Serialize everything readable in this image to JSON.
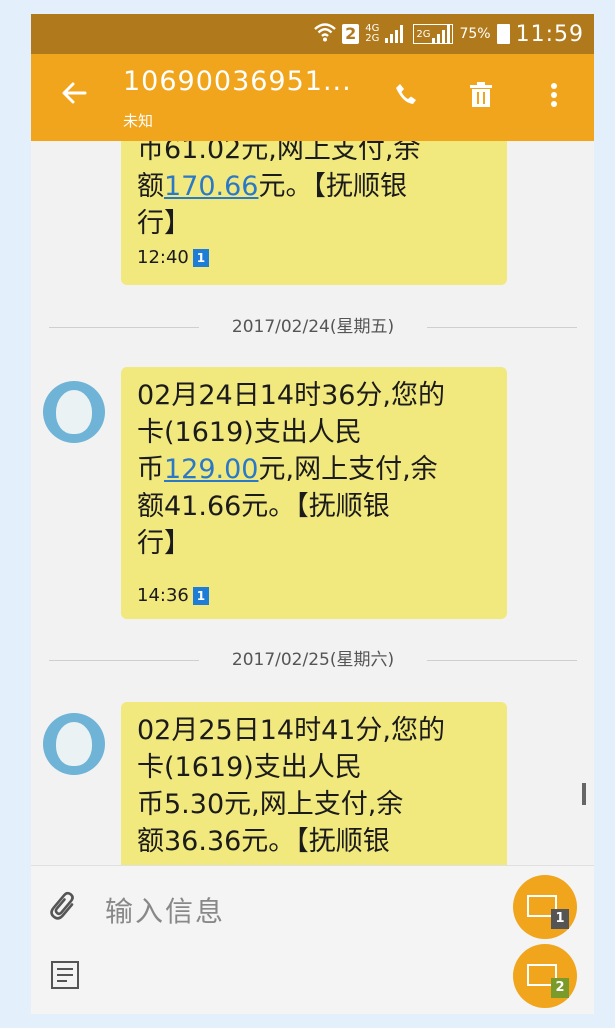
{
  "status_bar": {
    "wifi_icon": "wifi-icon",
    "sim_badge": "2",
    "network_top": "4G",
    "network_bottom": "2G",
    "network_2g": "2G",
    "battery_percent": "75%",
    "time": "11:59"
  },
  "app_bar": {
    "title": "10690036951...",
    "subtitle": "未知",
    "back_icon": "arrow-left-icon",
    "call_icon": "phone-icon",
    "delete_icon": "trash-icon",
    "more_icon": "more-vert-icon"
  },
  "messages": [
    {
      "lines": [
        "币61.02元,网上支付,余"
      ],
      "pre": "额",
      "amount": "170.66",
      "post": "元。【抚顺银",
      "line_last": "行】",
      "time": "12:40",
      "sim": "1"
    },
    {
      "line1": "02月24日14时36分,您的",
      "line2": "卡(1619)支出人民",
      "pre": "币",
      "amount": "129.00",
      "post": "元,网上支付,余",
      "line4": "额41.66元。【抚顺银",
      "line5": "行】",
      "time": "14:36",
      "sim": "1"
    },
    {
      "line1": "02月25日14时41分,您的",
      "line2": "卡(1619)支出人民",
      "line3": "币5.30元,网上支付,余",
      "line4": "额36.36元。【抚顺银"
    }
  ],
  "dividers": [
    "2017/02/24(星期五)",
    "2017/02/25(星期六)"
  ],
  "input": {
    "placeholder": "输入信息",
    "attach_icon": "paperclip-icon",
    "template_icon": "template-icon",
    "send_sim1": "1",
    "send_sim2": "2"
  },
  "colors": {
    "app_bar": "#f0a51c",
    "status_bar": "#b07a1c",
    "bubble": "#f1e87e",
    "link": "#2a78c8"
  }
}
